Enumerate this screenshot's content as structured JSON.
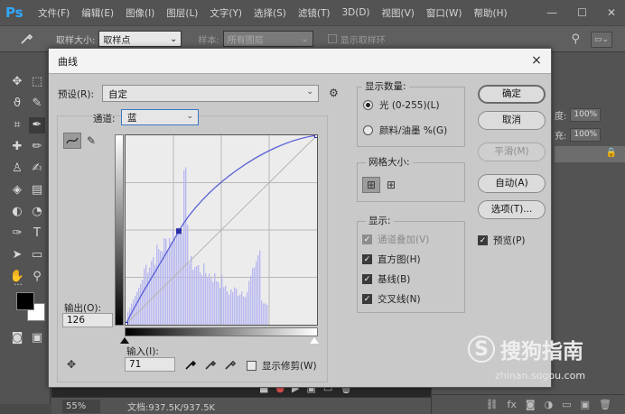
{
  "app": {
    "logo": "Ps",
    "menu": [
      "文件(F)",
      "编辑(E)",
      "图像(I)",
      "图层(L)",
      "文字(Y)",
      "选择(S)",
      "滤镜(T)",
      "3D(D)",
      "视图(V)",
      "窗口(W)",
      "帮助(H)"
    ]
  },
  "options_bar": {
    "sample_size_label": "取样大小:",
    "sample_size_value": "取样点",
    "sample_label": "样本:",
    "sample_value": "所有图层",
    "show_ring_label": "显示取样环"
  },
  "status_bar": {
    "zoom": "55%",
    "doc_info": "文档:937.5K/937.5K"
  },
  "right_panel": {
    "opacity_label": "度:",
    "opacity_value": "100%",
    "fill_label": "充:",
    "fill_value": "100%"
  },
  "watermark": {
    "text": "搜狗指南",
    "url": "zhinan.sogou.com"
  },
  "dialog": {
    "title": "曲线",
    "close": "×",
    "preset_label": "预设(R):",
    "preset_value": "自定",
    "channel_label": "通道:",
    "channel_value": "蓝",
    "output_label": "输出(O):",
    "output_value": "126",
    "input_label": "输入(I):",
    "input_value": "71",
    "show_clipping_label": "显示修剪(W)",
    "display_amount": {
      "title": "显示数量:",
      "option_light": "光 (0-255)(L)",
      "option_pigment": "颜料/油墨 %(G)",
      "selected": "light"
    },
    "grid_size": {
      "title": "网格大小:"
    },
    "show": {
      "title": "显示:",
      "channel_overlays": "通道叠加(V)",
      "histogram": "直方图(H)",
      "baseline": "基线(B)",
      "intersection_line": "交叉线(N)"
    },
    "buttons": {
      "ok": "确定",
      "cancel": "取消",
      "smooth": "平滑(M)",
      "auto": "自动(A)",
      "options": "选项(T)..."
    },
    "preview_label": "预览(P)",
    "curve_points": [
      [
        0,
        0
      ],
      [
        71,
        126
      ],
      [
        255,
        255
      ]
    ],
    "colors": {
      "curve": "#5a5fd6",
      "histogram": "#b9b9f0",
      "dialog_bg": "#c9c9c9"
    }
  }
}
